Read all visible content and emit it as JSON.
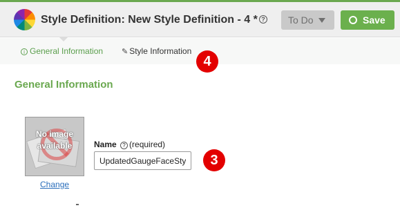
{
  "header": {
    "title": "Style Definition: New Style Definition - 4 *",
    "help_icon": "?",
    "status_dropdown": {
      "selected": "To Do"
    },
    "save_label": "Save"
  },
  "tabs": [
    {
      "label": "General Information",
      "icon": "info-circle-icon",
      "active": true
    },
    {
      "label": "Style Information",
      "icon": "style-icon",
      "active": false
    }
  ],
  "annotations": {
    "step_4": "4",
    "step_3": "3"
  },
  "main": {
    "section_title": "General Information",
    "image": {
      "placeholder_text": "No image available",
      "change_label": "Change"
    },
    "name_field": {
      "label": "Name",
      "help": "?",
      "required_text": "(required)",
      "value": "UpdatedGaugeFaceSty"
    }
  },
  "colors": {
    "accent_green": "#6aa84f",
    "save_green": "#6bb04d",
    "badge_red": "#e30000",
    "link_blue": "#2a6ebb"
  }
}
